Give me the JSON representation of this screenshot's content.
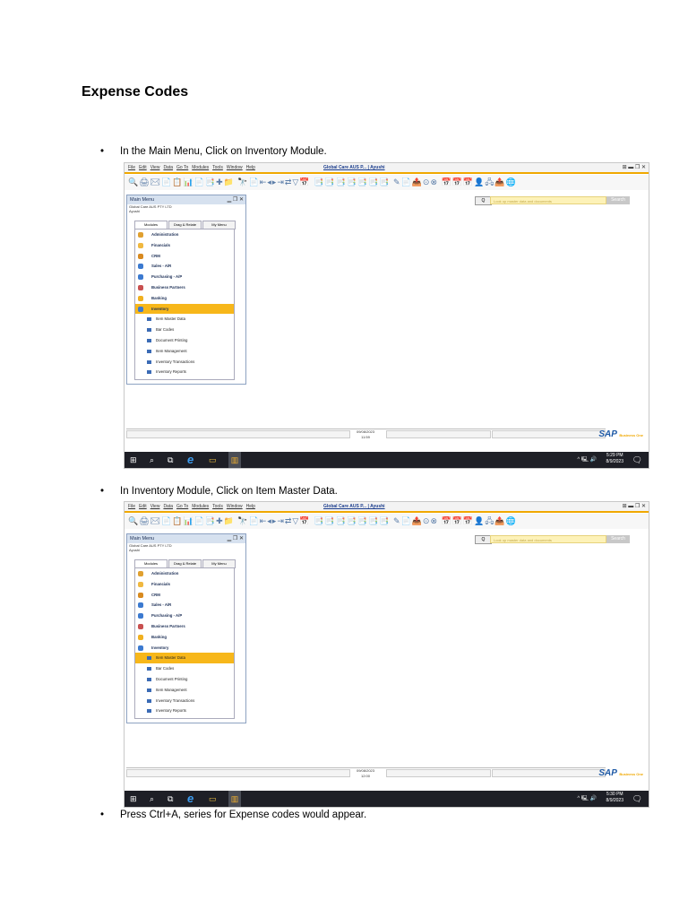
{
  "doc": {
    "title": "Expense Codes",
    "bullets": [
      "In the Main Menu, Click on Inventory Module.",
      "In Inventory Module, Click on Item Master Data.",
      "Press Ctrl+A, series for Expense codes would appear."
    ],
    "bullet_glyph": "•"
  },
  "app": {
    "menu_items": [
      "File",
      "Edit",
      "View",
      "Data",
      "Go To",
      "Modules",
      "Tools",
      "Window",
      "Help"
    ],
    "window_title": "Global Care AUS P... | Ayushi",
    "window_controls": "⊞ ▬ ❐ ✕",
    "toolbar_glyphs": "🔍🖨✉📄📋📊📄📑✚📁 🔭📄⇤◂▸⇥⇄▽📅 📑📑📑📑📑📑📑 ✎📄📤⊙⊗ 📅📅📅👤🖧📤🌐",
    "main_menu_title": "Main Menu",
    "main_menu_controls": "▁ ❐ ✕",
    "company": "Global Care AUS PTY LTD",
    "user": "Ayushi",
    "tabs": [
      "Modules",
      "Drag & Relate",
      "My Menu"
    ],
    "modules": [
      {
        "label": "Administration",
        "color": "#e0a030"
      },
      {
        "label": "Financials",
        "color": "#f0b840"
      },
      {
        "label": "CRM",
        "color": "#d88a20"
      },
      {
        "label": "Sales - A/R",
        "color": "#3c7ad0"
      },
      {
        "label": "Purchasing - A/P",
        "color": "#3c7ad0"
      },
      {
        "label": "Business Partners",
        "color": "#c85050"
      },
      {
        "label": "Banking",
        "color": "#f0b020"
      },
      {
        "label": "Inventory",
        "color": "#3c7ad0"
      }
    ],
    "submodules": [
      "Item Master Data",
      "Bar Codes",
      "Document Printing",
      "Item Management",
      "Inventory Transactions",
      "Inventory Reports"
    ],
    "search_placeholder": "Look up master data and documents",
    "search_button": "Search",
    "search_icon": "Q",
    "scroll_up": "▲",
    "scroll_down": "▼",
    "sap_logo": "SAP",
    "sap_tag": "Business One",
    "taskbar_glyphs": [
      "⊞",
      "⌕",
      "⧉",
      "e",
      "▭",
      "▥"
    ],
    "tray_icons": "^ 🖳 🔊",
    "notification_icon": "🗨"
  },
  "screens": [
    {
      "status_date": "09/08/2023",
      "status_time": "11:59",
      "clock_time": "5:29 PM",
      "clock_date": "8/9/2023",
      "selected": "Inventory"
    },
    {
      "status_date": "09/08/2023",
      "status_time": "12:00",
      "clock_time": "5:30 PM",
      "clock_date": "8/9/2023",
      "selected": "Item Master Data"
    }
  ]
}
